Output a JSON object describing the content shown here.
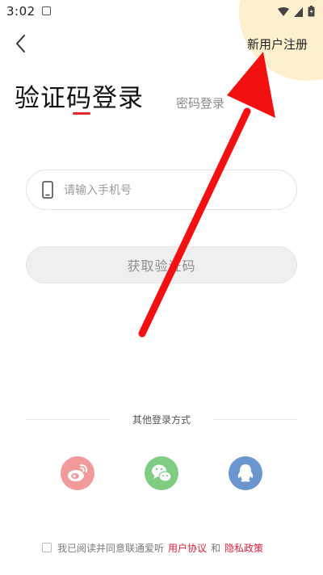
{
  "status_bar": {
    "time": "3:02"
  },
  "header": {
    "register_label": "新用户注册"
  },
  "tabs": {
    "sms_login": "验证码登录",
    "password_login": "密码登录"
  },
  "form": {
    "phone_placeholder": "请输入手机号",
    "get_code_label": "获取验证码"
  },
  "other_login": {
    "label": "其他登录方式",
    "providers": [
      "weibo-icon",
      "wechat-icon",
      "qq-icon"
    ]
  },
  "agreement": {
    "text": "我已阅读并同意联通爱听",
    "user_agreement": "用户协议",
    "and": "和",
    "privacy_policy": "隐私政策"
  },
  "colors": {
    "accent": "#e4262d",
    "arrow": "#f21010",
    "weibo": "#f19a9b",
    "wechat": "#7fcd83",
    "qq": "#6b95cd",
    "highlight": "#fbeeca"
  }
}
